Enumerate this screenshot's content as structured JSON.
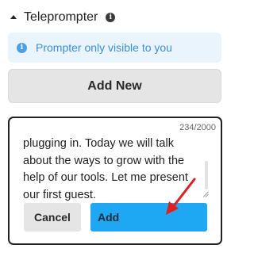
{
  "panel": {
    "title": "Teleprompter",
    "info_icon": "i"
  },
  "notice": {
    "icon": "i",
    "text": "Prompter only visible to you"
  },
  "add_new": {
    "label": "Add New"
  },
  "editor": {
    "counter": "234/2000",
    "text": "plugging in. Today we will talk about the ways to grow with the help of our tools. Let me present our first guest.",
    "cancel_label": "Cancel",
    "add_label": "Add"
  },
  "colors": {
    "accent": "#1ea7f3",
    "notice_bg": "#eaf4fd",
    "notice_text": "#3a8fda",
    "annotation_arrow": "#e02020"
  }
}
